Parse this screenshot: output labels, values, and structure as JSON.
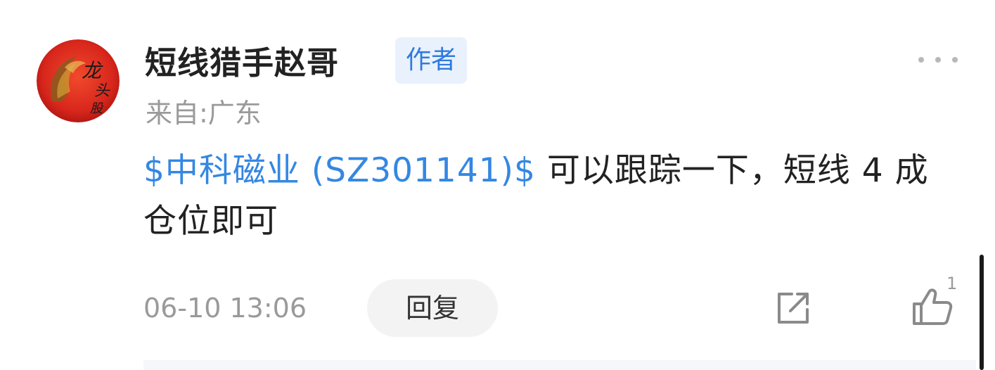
{
  "author": {
    "username": "短线猎手赵哥",
    "badge": "作者",
    "location": "来自:广东",
    "avatar_icon": "dragon-avatar-icon",
    "avatar_text": "龙头股"
  },
  "post": {
    "stock_link": "$中科磁业 (SZ301141)$",
    "text": " 可以跟踪一下，短线 4 成仓位即可"
  },
  "footer": {
    "timestamp": "06-10 13:06",
    "reply_label": "回复",
    "share_icon": "share-icon",
    "like_icon": "thumbs-up-icon",
    "like_count": "1"
  },
  "colors": {
    "link": "#3487e2",
    "badge_bg": "#e9f1fc",
    "badge_text": "#2f7ae0",
    "muted": "#9a9a9a",
    "avatar_red": "#d8261c"
  }
}
